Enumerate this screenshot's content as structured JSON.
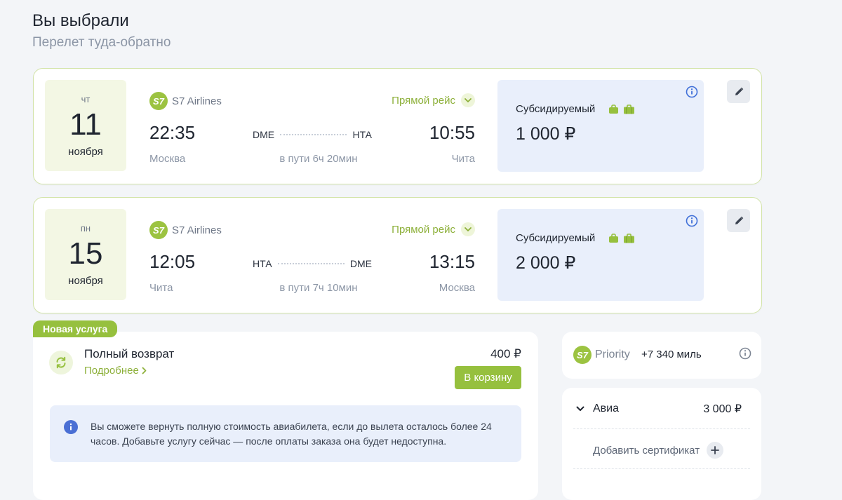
{
  "header": {
    "title": "Вы выбрали",
    "subtitle": "Перелет туда-обратно"
  },
  "flights": [
    {
      "dow": "чт",
      "day": "11",
      "month": "ноября",
      "airline_logo": "S7",
      "airline": "S7 Airlines",
      "direct_label": "Прямой рейс",
      "dep_time": "22:35",
      "arr_time": "10:55",
      "dep_code": "DME",
      "arr_code": "НТА",
      "dep_city": "Москва",
      "arr_city": "Чита",
      "duration": "в пути 6ч 20мин",
      "fare_name": "Субсидируемый",
      "fare_price": "1 000 ₽"
    },
    {
      "dow": "пн",
      "day": "15",
      "month": "ноября",
      "airline_logo": "S7",
      "airline": "S7 Airlines",
      "direct_label": "Прямой рейс",
      "dep_time": "12:05",
      "arr_time": "13:15",
      "dep_code": "НТА",
      "arr_code": "DME",
      "dep_city": "Чита",
      "arr_city": "Москва",
      "duration": "в пути 7ч 10мин",
      "fare_name": "Субсидируемый",
      "fare_price": "2 000 ₽"
    }
  ],
  "refund": {
    "badge": "Новая услуга",
    "title": "Полный возврат",
    "more": "Подробнее",
    "price": "400 ₽",
    "cart_button": "В корзину",
    "note": "Вы сможете вернуть полную стоимость авиабилета, если до вылета осталось более 24 часов. Добавьте услугу сейчас — после оплаты заказа она будет недоступна."
  },
  "priority": {
    "logo": "S7",
    "word": "Priority",
    "miles": "+7 340 миль"
  },
  "summary": {
    "label": "Авиа",
    "amount": "3 000 ₽",
    "add_certificate": "Добавить сертификат"
  },
  "icons": {
    "info": "info-icon",
    "edit": "pencil-icon",
    "chevron": "chevron-down-icon",
    "bags": [
      "hand-bag-icon",
      "suitcase-icon"
    ],
    "refresh": "refresh-icon",
    "plus": "plus-icon"
  },
  "colors": {
    "accent_green": "#96c03e",
    "fare_bg": "#e9effb",
    "date_bg": "#f3f7e4",
    "info_blue": "#3f6fd8"
  }
}
